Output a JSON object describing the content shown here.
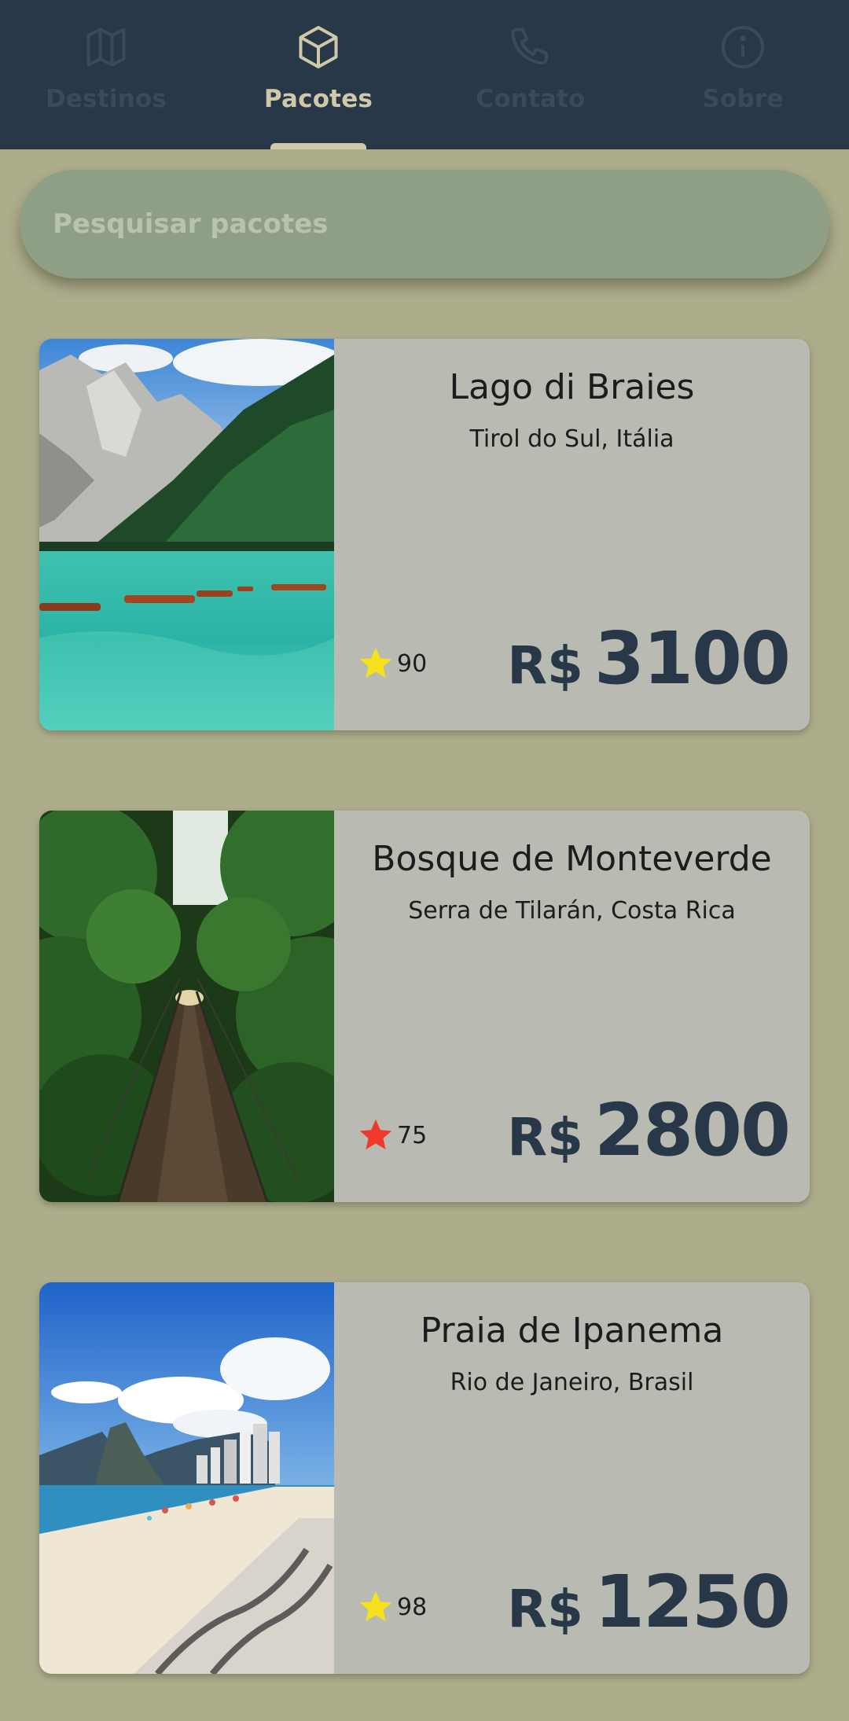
{
  "nav": {
    "tabs": [
      {
        "label": "Destinos",
        "icon": "map-icon",
        "active": false
      },
      {
        "label": "Pacotes",
        "icon": "box-icon",
        "active": true
      },
      {
        "label": "Contato",
        "icon": "phone-icon",
        "active": false
      },
      {
        "label": "Sobre",
        "icon": "info-icon",
        "active": false
      }
    ]
  },
  "search": {
    "placeholder": "Pesquisar pacotes",
    "value": ""
  },
  "packages": [
    {
      "name": "Lago di Braies",
      "location": "Tirol do Sul, Itália",
      "rating": "90",
      "star_color": "#f6e21c",
      "currency": "R$",
      "price": "3100",
      "image": "lake-mountain-photo"
    },
    {
      "name": "Bosque de Monteverde",
      "location": "Serra de Tilarán, Costa Rica",
      "rating": "75",
      "star_color": "#f0392b",
      "currency": "R$",
      "price": "2800",
      "image": "forest-bridge-photo"
    },
    {
      "name": "Praia de Ipanema",
      "location": "Rio de Janeiro, Brasil",
      "rating": "98",
      "star_color": "#f6e21c",
      "currency": "R$",
      "price": "1250",
      "image": "beach-city-photo"
    }
  ],
  "colors": {
    "topbar": "#283849",
    "background": "#adad8c",
    "accent": "#cfc9a9",
    "card": "#b9bbb2",
    "price": "#283849"
  }
}
